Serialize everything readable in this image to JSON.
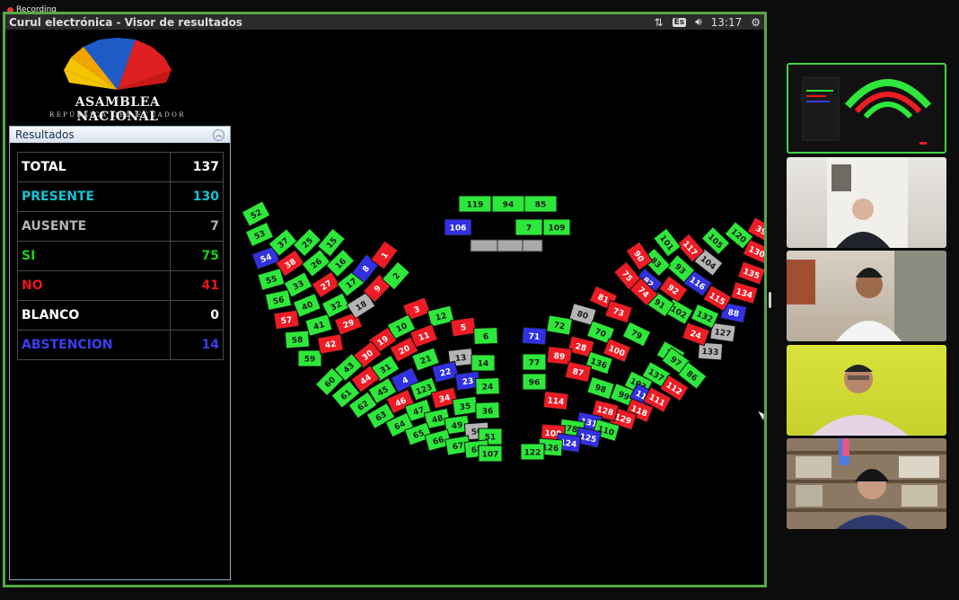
{
  "recording": "Recording",
  "window": {
    "title": "Curul electrónica - Visor de resultados",
    "lang": "Es",
    "time": "13:17"
  },
  "logo": {
    "name": "ASAMBLEA NACIONAL",
    "subtitle": "REPÚBLICA DEL ECUADOR"
  },
  "results": {
    "header": "Resultados",
    "rows": [
      {
        "label": "TOTAL",
        "value": "137",
        "color": "#ffffff"
      },
      {
        "label": "PRESENTE",
        "value": "130",
        "color": "#16c4d4"
      },
      {
        "label": "AUSENTE",
        "value": "7",
        "color": "#b5b5b5"
      },
      {
        "label": "SI",
        "value": "75",
        "color": "#18d318"
      },
      {
        "label": "NO",
        "value": "41",
        "color": "#e81818"
      },
      {
        "label": "BLANCO",
        "value": "0",
        "color": "#ffffff"
      },
      {
        "label": "ABSTENCION",
        "value": "14",
        "color": "#3c3cf0"
      }
    ]
  },
  "seat_colors": {
    "si": "#2de83a",
    "no": "#ee1c24",
    "abstencion": "#3131e2",
    "ausente": "#b4b4b4"
  },
  "seats": [
    {
      "n": "119",
      "v": "si"
    },
    {
      "n": "94",
      "v": "si"
    },
    {
      "n": "85",
      "v": "si"
    },
    {
      "n": "106",
      "v": "abstencion"
    },
    {
      "n": "7",
      "v": "si"
    },
    {
      "n": "109",
      "v": "si"
    },
    {
      "n": "52",
      "v": "si"
    },
    {
      "n": "53",
      "v": "si"
    },
    {
      "n": "54",
      "v": "abstencion"
    },
    {
      "n": "55",
      "v": "si"
    },
    {
      "n": "56",
      "v": "si"
    },
    {
      "n": "57",
      "v": "no"
    },
    {
      "n": "58",
      "v": "si"
    },
    {
      "n": "59",
      "v": "si"
    },
    {
      "n": "37",
      "v": "si"
    },
    {
      "n": "38",
      "v": "no"
    },
    {
      "n": "33",
      "v": "si"
    },
    {
      "n": "40",
      "v": "si"
    },
    {
      "n": "41",
      "v": "si"
    },
    {
      "n": "42",
      "v": "no"
    },
    {
      "n": "25",
      "v": "si"
    },
    {
      "n": "26",
      "v": "si"
    },
    {
      "n": "27",
      "v": "no"
    },
    {
      "n": "32",
      "v": "si"
    },
    {
      "n": "29",
      "v": "no"
    },
    {
      "n": "15",
      "v": "si"
    },
    {
      "n": "16",
      "v": "si"
    },
    {
      "n": "17",
      "v": "si"
    },
    {
      "n": "18",
      "v": "ausente"
    },
    {
      "n": "8",
      "v": "abstencion"
    },
    {
      "n": "9",
      "v": "no"
    },
    {
      "n": "1",
      "v": "no"
    },
    {
      "n": "2",
      "v": "si"
    },
    {
      "n": "3",
      "v": "no"
    },
    {
      "n": "12",
      "v": "si"
    },
    {
      "n": "5",
      "v": "no"
    },
    {
      "n": "6",
      "v": "si"
    },
    {
      "n": "10",
      "v": "si"
    },
    {
      "n": "11",
      "v": "no"
    },
    {
      "n": "13",
      "v": "ausente"
    },
    {
      "n": "14",
      "v": "si"
    },
    {
      "n": "19",
      "v": "no"
    },
    {
      "n": "20",
      "v": "no"
    },
    {
      "n": "21",
      "v": "si"
    },
    {
      "n": "22",
      "v": "abstencion"
    },
    {
      "n": "23",
      "v": "abstencion"
    },
    {
      "n": "24",
      "v": "si"
    },
    {
      "n": "30",
      "v": "no"
    },
    {
      "n": "31",
      "v": "si"
    },
    {
      "n": "4",
      "v": "abstencion"
    },
    {
      "n": "123",
      "v": "si"
    },
    {
      "n": "34",
      "v": "no"
    },
    {
      "n": "35",
      "v": "si"
    },
    {
      "n": "36",
      "v": "si"
    },
    {
      "n": "43",
      "v": "si"
    },
    {
      "n": "44",
      "v": "no"
    },
    {
      "n": "45",
      "v": "si"
    },
    {
      "n": "46",
      "v": "no"
    },
    {
      "n": "47",
      "v": "si"
    },
    {
      "n": "48",
      "v": "si"
    },
    {
      "n": "49",
      "v": "si"
    },
    {
      "n": "50",
      "v": "ausente"
    },
    {
      "n": "51",
      "v": "si"
    },
    {
      "n": "60",
      "v": "si"
    },
    {
      "n": "61",
      "v": "si"
    },
    {
      "n": "62",
      "v": "si"
    },
    {
      "n": "63",
      "v": "si"
    },
    {
      "n": "64",
      "v": "si"
    },
    {
      "n": "65",
      "v": "si"
    },
    {
      "n": "66",
      "v": "si"
    },
    {
      "n": "67",
      "v": "si"
    },
    {
      "n": "68",
      "v": "si"
    },
    {
      "n": "107",
      "v": "si"
    },
    {
      "n": "39",
      "v": "no"
    },
    {
      "n": "130",
      "v": "no"
    },
    {
      "n": "135",
      "v": "no"
    },
    {
      "n": "134",
      "v": "no"
    },
    {
      "n": "88",
      "v": "abstencion"
    },
    {
      "n": "127",
      "v": "ausente"
    },
    {
      "n": "133",
      "v": "ausente"
    },
    {
      "n": "120",
      "v": "si"
    },
    {
      "n": "105",
      "v": "si"
    },
    {
      "n": "104",
      "v": "ausente"
    },
    {
      "n": "116",
      "v": "abstencion"
    },
    {
      "n": "115",
      "v": "no"
    },
    {
      "n": "132",
      "v": "si"
    },
    {
      "n": "24",
      "v": "no"
    },
    {
      "n": "117",
      "v": "no"
    },
    {
      "n": "93",
      "v": "si"
    },
    {
      "n": "92",
      "v": "no"
    },
    {
      "n": "102",
      "v": "si"
    },
    {
      "n": "101",
      "v": "si"
    },
    {
      "n": "83",
      "v": "si"
    },
    {
      "n": "82",
      "v": "abstencion"
    },
    {
      "n": "91",
      "v": "si"
    },
    {
      "n": "90",
      "v": "no"
    },
    {
      "n": "75",
      "v": "no"
    },
    {
      "n": "74",
      "v": "no"
    },
    {
      "n": "81",
      "v": "no"
    },
    {
      "n": "73",
      "v": "no"
    },
    {
      "n": "80",
      "v": "ausente"
    },
    {
      "n": "72",
      "v": "si"
    },
    {
      "n": "71",
      "v": "abstencion"
    },
    {
      "n": "70",
      "v": "si"
    },
    {
      "n": "79",
      "v": "si"
    },
    {
      "n": "28",
      "v": "no"
    },
    {
      "n": "100",
      "v": "no"
    },
    {
      "n": "89",
      "v": "no"
    },
    {
      "n": "77",
      "v": "si"
    },
    {
      "n": "76",
      "v": "si"
    },
    {
      "n": "136",
      "v": "si"
    },
    {
      "n": "87",
      "v": "no"
    },
    {
      "n": "96",
      "v": "si"
    },
    {
      "n": "97",
      "v": "si"
    },
    {
      "n": "137",
      "v": "si"
    },
    {
      "n": "103",
      "v": "si"
    },
    {
      "n": "98",
      "v": "si"
    },
    {
      "n": "99",
      "v": "si"
    },
    {
      "n": "113",
      "v": "abstencion"
    },
    {
      "n": "114",
      "v": "no"
    },
    {
      "n": "86",
      "v": "si"
    },
    {
      "n": "112",
      "v": "no"
    },
    {
      "n": "111",
      "v": "no"
    },
    {
      "n": "118",
      "v": "no"
    },
    {
      "n": "129",
      "v": "no"
    },
    {
      "n": "128",
      "v": "no"
    },
    {
      "n": "131",
      "v": "abstencion"
    },
    {
      "n": "78",
      "v": "si"
    },
    {
      "n": "108",
      "v": "no"
    },
    {
      "n": "110",
      "v": "si"
    },
    {
      "n": "125",
      "v": "abstencion"
    },
    {
      "n": "124",
      "v": "abstencion"
    },
    {
      "n": "126",
      "v": "si"
    },
    {
      "n": "122",
      "v": "si"
    },
    {
      "n": "121",
      "v": "no"
    }
  ]
}
